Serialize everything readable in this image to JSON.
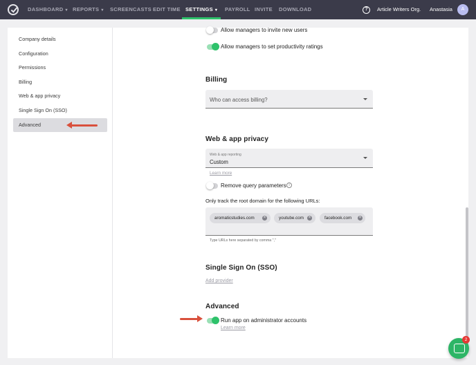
{
  "nav": {
    "items": [
      {
        "label": "DASHBOARD",
        "caret": true
      },
      {
        "label": "REPORTS",
        "caret": true
      },
      {
        "label": "SCREENCASTS",
        "caret": false
      },
      {
        "label": "EDIT TIME",
        "caret": false
      },
      {
        "label": "SETTINGS",
        "caret": true
      },
      {
        "label": "PAYROLL",
        "caret": false
      },
      {
        "label": "INVITE",
        "caret": false
      },
      {
        "label": "DOWNLOAD",
        "caret": false
      }
    ],
    "active": "SETTINGS",
    "help_glyph": "?",
    "org_name": "Article Writers Org.",
    "user_name": "Anastasia",
    "avatar_initial": "A",
    "active_color": "#2ec26b"
  },
  "sidebar": {
    "items": [
      {
        "label": "Company details"
      },
      {
        "label": "Configuration"
      },
      {
        "label": "Permissions"
      },
      {
        "label": "Billing"
      },
      {
        "label": "Web & app privacy"
      },
      {
        "label": "Single Sign On (SSO)"
      },
      {
        "label": "Advanced",
        "active": true
      }
    ]
  },
  "content": {
    "toggle_invite": {
      "label": "Allow managers to invite new users",
      "on": false
    },
    "toggle_productivity": {
      "label": "Allow managers to set productivity ratings",
      "on": true
    },
    "billing": {
      "heading": "Billing",
      "select_placeholder": "Who can access billing?"
    },
    "web_app_privacy": {
      "heading": "Web & app privacy",
      "select_label": "Web & app reporting",
      "select_value": "Custom",
      "learn_more": "Learn more",
      "toggle_query": {
        "label": "Remove query parameters",
        "on": false
      },
      "info_glyph": "i",
      "urls_label": "Only track the root domain for the following URLs:",
      "chips": [
        "aromaticstudies.com",
        "youtube.com",
        "facebook.com"
      ],
      "chip_remove_glyph": "×",
      "helper": "Type URLs here separated by comma \",\""
    },
    "sso": {
      "heading": "Single Sign On (SSO)",
      "add_provider": "Add provider"
    },
    "advanced": {
      "heading": "Advanced",
      "toggle_admin": {
        "label": "Run app on administrator accounts",
        "on": true
      },
      "learn_more": "Learn more"
    }
  },
  "chat": {
    "badge": "2"
  },
  "annotation_color": "#d9503c"
}
